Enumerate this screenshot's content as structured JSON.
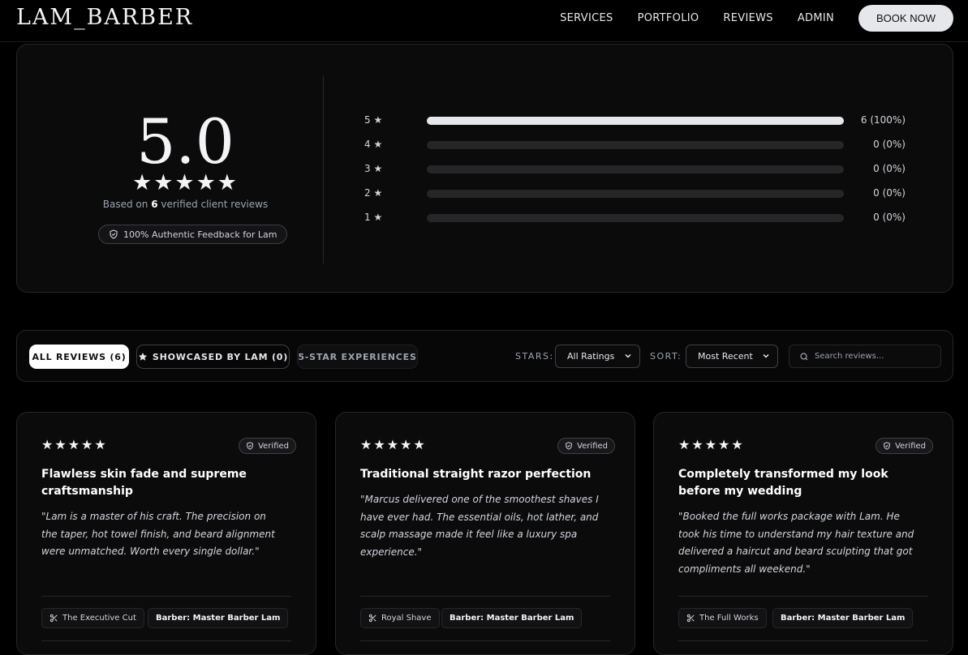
{
  "nav": {
    "logo": "LAM_BARBER",
    "links": [
      "SERVICES",
      "PORTFOLIO",
      "REVIEWS",
      "ADMIN"
    ],
    "cta": "BOOK NOW"
  },
  "summary": {
    "score": "5.0",
    "stars": "★★★★★",
    "based_prefix": "Based on ",
    "based_count": "6",
    "based_suffix": " verified client reviews",
    "authentic": "100% Authentic Feedback for Lam",
    "breakdown": [
      {
        "label": "5 ★",
        "count": "6 (100%)",
        "fraction": 1.0
      },
      {
        "label": "4 ★",
        "count": "0 (0%)",
        "fraction": 0
      },
      {
        "label": "3 ★",
        "count": "0 (0%)",
        "fraction": 0
      },
      {
        "label": "2 ★",
        "count": "0 (0%)",
        "fraction": 0
      },
      {
        "label": "1 ★",
        "count": "0 (0%)",
        "fraction": 0
      }
    ]
  },
  "filters": {
    "tabs": {
      "all": "ALL REVIEWS (6)",
      "showcased": "SHOWCASED BY LAM (0)",
      "five_star": "5-STAR EXPERIENCES"
    },
    "stars_label": "STARS:",
    "stars_value": "All Ratings",
    "sort_label": "SORT:",
    "sort_value": "Most Recent",
    "search_placeholder": "Search reviews..."
  },
  "reviews": [
    {
      "stars": "★★★★★",
      "verified": "Verified",
      "title": "Flawless skin fade and supreme craftsmanship",
      "body": "\"Lam is a master of his craft. The precision on the taper, hot towel finish, and beard alignment were unmatched. Worth every single dollar.\"",
      "service": "The Executive Cut",
      "barber": "Barber: Master Barber Lam"
    },
    {
      "stars": "★★★★★",
      "verified": "Verified",
      "title": "Traditional straight razor perfection",
      "body": "\"Marcus delivered one of the smoothest shaves I have ever had. The essential oils, hot lather, and scalp massage made it feel like a luxury spa experience.\"",
      "service": "Royal Shave",
      "barber": "Barber: Master Barber Lam"
    },
    {
      "stars": "★★★★★",
      "verified": "Verified",
      "title": "Completely transformed my look before my wedding",
      "body": "\"Booked the full works package with Lam. He took his time to understand my hair texture and delivered a haircut and beard sculpting that got compliments all weekend.\"",
      "service": "The Full Works",
      "barber": "Barber: Master Barber Lam"
    }
  ]
}
